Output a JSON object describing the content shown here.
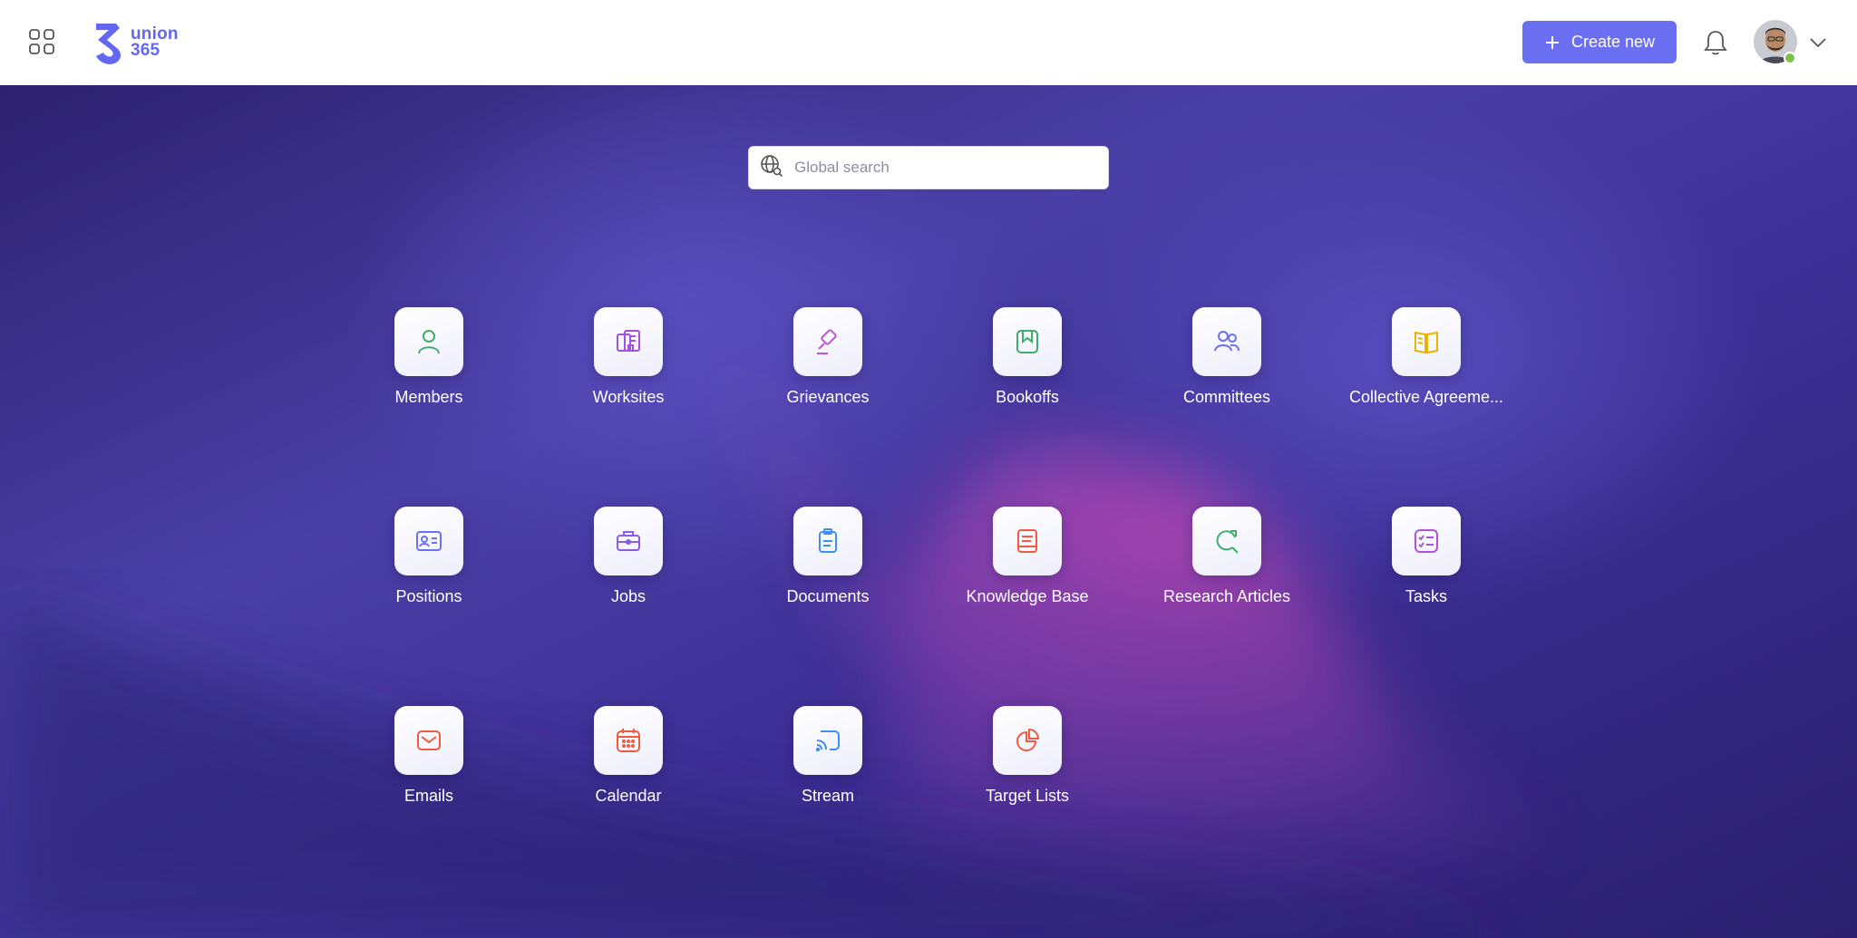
{
  "header": {
    "logo_line1": "union",
    "logo_line2": "365",
    "create_label": "Create new"
  },
  "search": {
    "placeholder": "Global search"
  },
  "apps": [
    {
      "label": "Members",
      "icon": "member-icon",
      "color": "#3fae6a"
    },
    {
      "label": "Worksites",
      "icon": "worksites-icon",
      "color": "#a34fe0"
    },
    {
      "label": "Grievances",
      "icon": "gavel-icon",
      "color": "#c44fe0"
    },
    {
      "label": "Bookoffs",
      "icon": "bookmark-icon",
      "color": "#3fae6a"
    },
    {
      "label": "Committees",
      "icon": "people-icon",
      "color": "#6b6ff2"
    },
    {
      "label": "Collective Agreeme...",
      "icon": "book-icon",
      "color": "#e8b400"
    },
    {
      "label": "Positions",
      "icon": "id-card-icon",
      "color": "#6b6ff2"
    },
    {
      "label": "Jobs",
      "icon": "briefcase-icon",
      "color": "#8a5ae8"
    },
    {
      "label": "Documents",
      "icon": "clipboard-icon",
      "color": "#3f8ff0"
    },
    {
      "label": "Knowledge Base",
      "icon": "knowledge-icon",
      "color": "#f05a3f"
    },
    {
      "label": "Research Articles",
      "icon": "research-icon",
      "color": "#3fae6a"
    },
    {
      "label": "Tasks",
      "icon": "checklist-icon",
      "color": "#b04fe0"
    },
    {
      "label": "Emails",
      "icon": "mail-icon",
      "color": "#f05a3f"
    },
    {
      "label": "Calendar",
      "icon": "calendar-icon",
      "color": "#f05a3f"
    },
    {
      "label": "Stream",
      "icon": "stream-icon",
      "color": "#3f8ff0"
    },
    {
      "label": "Target Lists",
      "icon": "pie-chart-icon",
      "color": "#f05a3f"
    }
  ]
}
